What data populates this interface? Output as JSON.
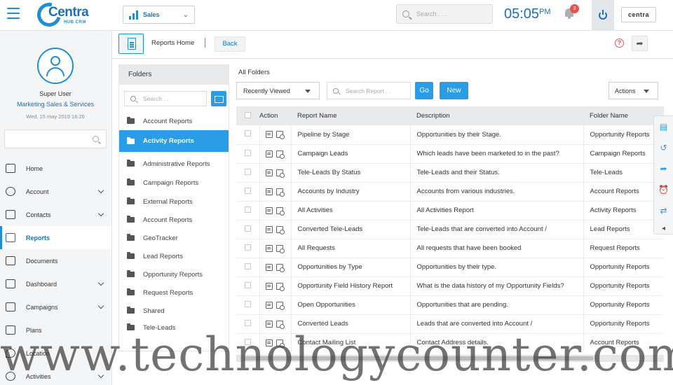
{
  "header": {
    "logo_text": "Centra",
    "logo_sub": "HUB CRM",
    "module": "Sales",
    "search_placeholder": "Search . . .",
    "time": "05:05",
    "time_suffix": "PM",
    "notification_count": "3",
    "brand_badge": "centra"
  },
  "user": {
    "name": "Super User",
    "role": "Marketing Sales & Services",
    "date": "Wed, 15 may 2019 16:26"
  },
  "nav": [
    {
      "label": "Home"
    },
    {
      "label": "Account"
    },
    {
      "label": "Contacts"
    },
    {
      "label": "Reports"
    },
    {
      "label": "Documents"
    },
    {
      "label": "Dashboard"
    },
    {
      "label": "Campaigns"
    },
    {
      "label": "Plans"
    },
    {
      "label": "Location"
    },
    {
      "label": "Activities"
    }
  ],
  "subheader": {
    "title": "Reports Home",
    "back_label": "Back",
    "help_glyph": "?"
  },
  "folders": {
    "heading": "Folders",
    "search_placeholder": "Search . .",
    "items": [
      "Account Reports",
      "Activity Reports",
      "Administrative Reports",
      "Campaign Reports",
      "External Reports",
      "Account Reports",
      "GeoTracker",
      "Lead Reports",
      "Opportunity Reports",
      "Request Reports",
      "Shared",
      "Tele-Leads"
    ]
  },
  "main": {
    "all_folders_label": "All Folders",
    "view_select": "Recently Viewed",
    "search_placeholder": "Search Report . .",
    "go_label": "Go",
    "new_label": "New",
    "actions_label": "Actions"
  },
  "table": {
    "headers": {
      "action": "Action",
      "name": "Report Name",
      "description": "Description",
      "folder": "Folder Name"
    },
    "rows": [
      {
        "name": "Pipeline by Stage",
        "description": "Opportunities by their Stage.",
        "folder": "Opportunity Reports"
      },
      {
        "name": "Campaign Leads",
        "description": "Which leads have been marketed to in the past?",
        "folder": "Campaign Reports"
      },
      {
        "name": "Tele-Leads By Status",
        "description": "Tele-Leads and their Status.",
        "folder": "Tele-Leads"
      },
      {
        "name": "Accounts by Industry",
        "description": "Accounts from various industries.",
        "folder": "Account Reports"
      },
      {
        "name": "All Activities",
        "description": "All Activities Report",
        "folder": "Activity Reports"
      },
      {
        "name": "Converted Tele-Leads",
        "description": "Tele-Leads that are converted into Account /",
        "folder": "Lead Reports"
      },
      {
        "name": "All Requests",
        "description": "All requests that have been booked",
        "folder": "Request Reports"
      },
      {
        "name": "Opportunities by Type",
        "description": "Opportunities by their type.",
        "folder": "Opportunity Reports"
      },
      {
        "name": "Opportunity Field History Report",
        "description": "What is the data history of my Opportunity Fields?",
        "folder": "Opportunity Reports"
      },
      {
        "name": "Open Opportunities",
        "description": "Opportunities that are pending.",
        "folder": "Opportunity Reports"
      },
      {
        "name": "Converted Leads",
        "description": "Leads that are converted into Account /",
        "folder": "Opportunity Reports"
      },
      {
        "name": "Contact Mailing List",
        "description": "Contact Address details.",
        "folder": "Account Reports"
      }
    ]
  },
  "watermark": "www.technologycounter.com",
  "colors": {
    "accent": "#2a9de6",
    "brand": "#1d6fb8",
    "alert": "#e9524e"
  }
}
